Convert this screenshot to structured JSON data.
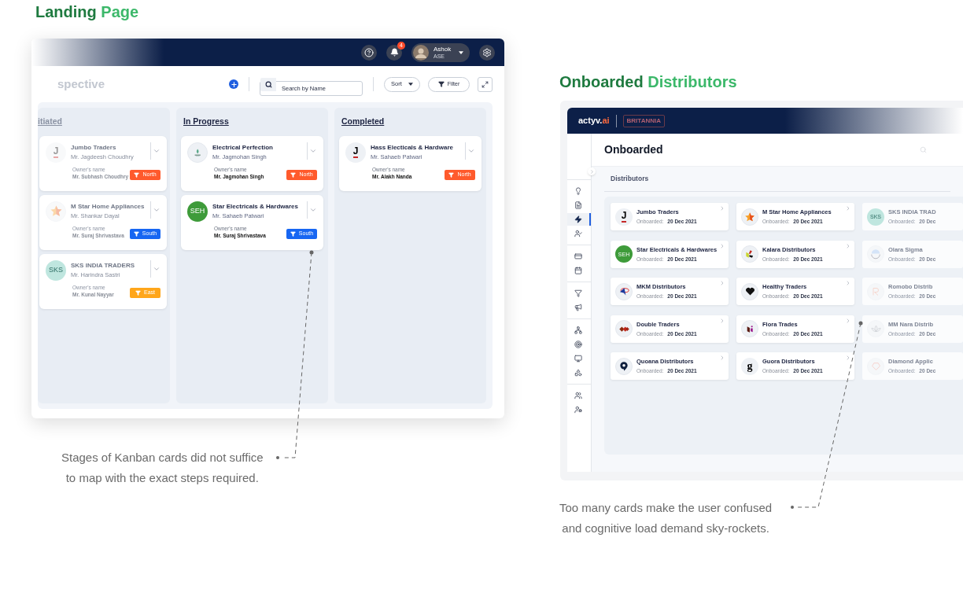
{
  "landing_heading": {
    "lead": "Landing",
    "rest": "Page"
  },
  "landing": {
    "header": {
      "notifications": "4",
      "user": {
        "name": "Ashok",
        "role": "ASE"
      }
    },
    "title": "spective",
    "search": {
      "placeholder": "Search by Name"
    },
    "sort": "Sort",
    "filter": "Filter",
    "columns": [
      {
        "title": "itiated",
        "faded": true,
        "cards": [
          {
            "logo": {
              "kind": "letter",
              "text": "J"
            },
            "name": "Jumbo Traders",
            "contact": "Mr. Jagdeesh Choudhry",
            "owner_label": "Owner's name",
            "owner": "Mr. Subhash Choudhry",
            "region": "North",
            "color": "#ff5a2c"
          },
          {
            "logo": {
              "kind": "star"
            },
            "name": "M Star Home Appliances",
            "contact": "Mr. Shankar Dayal",
            "owner_label": "Owner's name",
            "owner": "Mr. Suraj Shrivastava",
            "region": "South",
            "color": "#1766f2"
          },
          {
            "logo": {
              "kind": "initials",
              "text": "SKS",
              "color": "#bfe6df"
            },
            "name": "SKS INDIA TRADERS",
            "contact": "Mr. Harindra Sastri",
            "owner_label": "Owner's name",
            "owner": "Mr. Kunal Nayyar",
            "region": "East",
            "color": "#ffa61a"
          }
        ]
      },
      {
        "title": "In Progress",
        "faded": false,
        "cards": [
          {
            "logo": {
              "kind": "seal"
            },
            "name": "Electrical Perfection",
            "contact": "Mr. Jagmohan Singh",
            "owner_label": "Owner's name",
            "owner": "Mr. Jagmohan Singh",
            "region": "North",
            "color": "#ff5a2c"
          },
          {
            "logo": {
              "kind": "initials",
              "text": "SEH",
              "color": "#3e9b3a"
            },
            "name": "Star Electricals & Hardwares",
            "contact": "Mr. Sahaeb Patwari",
            "owner_label": "Owner's name",
            "owner": "Mr. Suraj Shrivastava",
            "region": "South",
            "color": "#1766f2"
          }
        ]
      },
      {
        "title": "Completed",
        "faded": false,
        "cards": [
          {
            "logo": {
              "kind": "letter",
              "text": "J"
            },
            "name": "Hass Electicals & Hardware",
            "contact": "Mr. Sahaeb Patwari",
            "owner_label": "Owner's name",
            "owner": "Mr. Alakh Nanda",
            "region": "North",
            "color": "#ff5a2c"
          }
        ]
      }
    ]
  },
  "caption_left": {
    "lines": [
      "Stages of Kanban cards did not suffice",
      "to map with the exact steps required."
    ]
  },
  "onboarded_heading": {
    "lead": "Onboarded",
    "rest": "Distributors"
  },
  "onboarded": {
    "brand": {
      "main": "actyv.",
      "accent": "ai"
    },
    "partner": "BRITANNIA",
    "title": "Onboarded",
    "tab": "Distributors",
    "sidebar": {
      "groups": [
        [
          {
            "kind": "bulb",
            "selected": false
          },
          {
            "kind": "document",
            "selected": false
          },
          {
            "kind": "bolt",
            "selected": true
          },
          {
            "kind": "user-check",
            "selected": false
          }
        ],
        [
          {
            "kind": "card",
            "selected": false
          },
          {
            "kind": "calendar",
            "selected": false
          }
        ],
        [
          {
            "kind": "funnel",
            "selected": false
          },
          {
            "kind": "megaphone",
            "selected": false
          }
        ],
        [
          {
            "kind": "hierarchy",
            "selected": false
          },
          {
            "kind": "target",
            "selected": false
          },
          {
            "kind": "screen",
            "selected": false
          },
          {
            "kind": "shapes",
            "selected": false
          }
        ],
        [
          {
            "kind": "group",
            "selected": false
          },
          {
            "kind": "user-gear",
            "selected": false
          }
        ]
      ]
    },
    "cards": [
      {
        "name": "Jumbo Traders",
        "label": "Onboarded:",
        "date": "20 Dec 2021",
        "faded": false,
        "logo": {
          "kind": "letter",
          "text": "J"
        }
      },
      {
        "name": "M Star Home Appliances",
        "label": "Onboarded:",
        "date": "20 Dec 2021",
        "faded": false,
        "logo": {
          "kind": "star"
        }
      },
      {
        "name": "SKS INDIA TRAD",
        "label": "Onboarded:",
        "date": "20 Dec",
        "faded": true,
        "logo": {
          "kind": "initials",
          "text": "SKS",
          "color": "#bfe6df"
        }
      },
      {
        "name": "Star Electricals & Hardwares",
        "label": "Onboarded:",
        "date": "20 Dec 2021",
        "faded": false,
        "logo": {
          "kind": "initials",
          "text": "SEH",
          "color": "#3e9b3a"
        }
      },
      {
        "name": "Kalara Distributors",
        "label": "Onboarded:",
        "date": "20 Dec 2021",
        "faded": false,
        "logo": {
          "kind": "leaf"
        }
      },
      {
        "name": "Olara Sigma",
        "label": "Onboarded:",
        "date": "20 Dec",
        "faded": true,
        "logo": {
          "kind": "arc"
        }
      },
      {
        "name": "MKM Distributors",
        "label": "Onboarded:",
        "date": "20 Dec 2021",
        "faded": false,
        "logo": {
          "kind": "bird"
        }
      },
      {
        "name": "Healthy Traders",
        "label": "Onboarded:",
        "date": "20 Dec 2021",
        "faded": false,
        "logo": {
          "kind": "heart"
        }
      },
      {
        "name": "Romobo Distrib",
        "label": "Onboarded:",
        "date": "20 Dec",
        "faded": true,
        "logo": {
          "kind": "monogram"
        }
      },
      {
        "name": "Double Traders",
        "label": "Onboarded:",
        "date": "20 Dec 2021",
        "faded": false,
        "logo": {
          "kind": "diamonds"
        }
      },
      {
        "name": "Flora Trades",
        "label": "Onboarded:",
        "date": "20 Dec 2021",
        "faded": false,
        "logo": {
          "kind": "flora"
        }
      },
      {
        "name": "MM Nara Distrib",
        "label": "Onboarded:",
        "date": "20 Dec",
        "faded": true,
        "logo": {
          "kind": "lotus"
        }
      },
      {
        "name": "Quoana Distributors",
        "label": "Onboarded:",
        "date": "20 Dec 2021",
        "faded": false,
        "logo": {
          "kind": "pin"
        }
      },
      {
        "name": "Guora Distributors",
        "label": "Onboarded:",
        "date": "20 Dec 2021",
        "faded": false,
        "logo": {
          "kind": "glyph",
          "text": "g"
        }
      },
      {
        "name": "Diamond Applic",
        "label": "Onboarded:",
        "date": "20 Dec",
        "faded": true,
        "logo": {
          "kind": "heart_outline"
        }
      }
    ]
  },
  "caption_right": {
    "lines": [
      "Too many cards make the user confused",
      "and cognitive load demand sky-rockets."
    ]
  }
}
